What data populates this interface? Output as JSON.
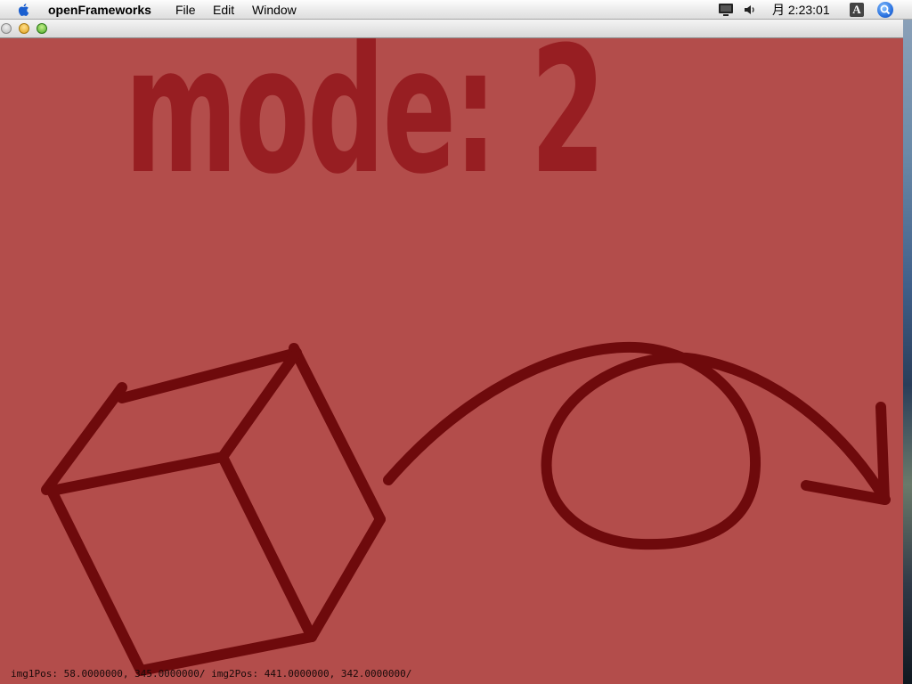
{
  "menubar": {
    "app_name": "openFrameworks",
    "menus": [
      "File",
      "Edit",
      "Window"
    ],
    "clock": "月 2:23:01",
    "input_menu_label": "A",
    "icons": {
      "apple": "apple-logo-icon",
      "display": "display-icon",
      "volume": "volume-icon",
      "spotlight": "spotlight-search-icon"
    }
  },
  "window": {
    "buttons": [
      "close",
      "minimize",
      "zoom"
    ]
  },
  "canvas": {
    "background_color": "#b34d4b",
    "mode_label": "mode: 2",
    "status": "img1Pos: 58.0000000, 345.0000000/ img2Pos: 441.0000000, 342.0000000/",
    "stroke_color": "#6e0a0c",
    "drawings": [
      "cube-sketch",
      "loop-arrow-sketch"
    ]
  }
}
